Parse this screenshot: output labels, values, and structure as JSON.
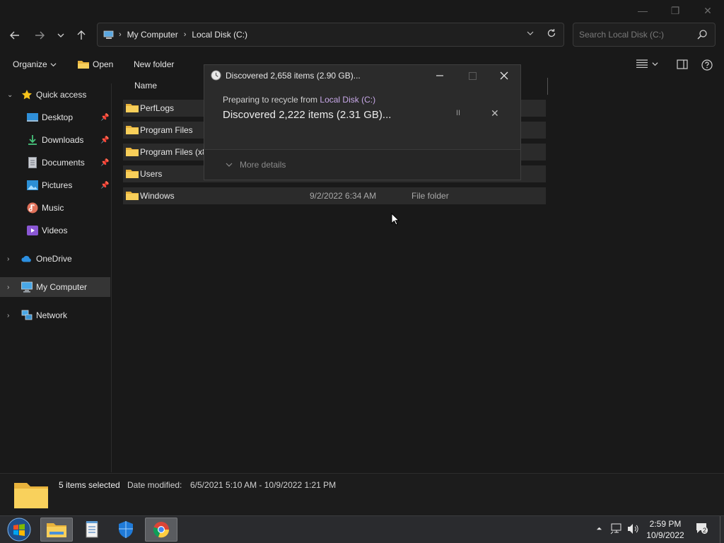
{
  "window": {
    "controls": {
      "minimize": "—",
      "restore": "❐",
      "close": "✕"
    }
  },
  "address": {
    "crumbs": [
      "My Computer",
      "Local Disk (C:)"
    ],
    "search_placeholder": "Search Local Disk (C:)"
  },
  "toolbar": {
    "organize": "Organize",
    "open": "Open",
    "new_folder": "New folder"
  },
  "sidebar": {
    "quick_access": "Quick access",
    "items": [
      {
        "label": "Desktop",
        "pinned": true
      },
      {
        "label": "Downloads",
        "pinned": true
      },
      {
        "label": "Documents",
        "pinned": true
      },
      {
        "label": "Pictures",
        "pinned": true
      },
      {
        "label": "Music",
        "pinned": false
      },
      {
        "label": "Videos",
        "pinned": false
      }
    ],
    "onedrive": "OneDrive",
    "my_computer": "My Computer",
    "network": "Network"
  },
  "file_list": {
    "column_name": "Name",
    "rows": [
      {
        "name": "PerfLogs",
        "date": "",
        "type": ""
      },
      {
        "name": "Program Files",
        "date": "",
        "type": ""
      },
      {
        "name": "Program Files (x8",
        "date": "",
        "type": ""
      },
      {
        "name": "Users",
        "date": "",
        "type": ""
      },
      {
        "name": "Windows",
        "date": "9/2/2022 6:34 AM",
        "type": "File folder"
      }
    ]
  },
  "dialog": {
    "title": "Discovered 2,658 items (2.90 GB)...",
    "subtitle_prefix": "Preparing to recycle from ",
    "subtitle_link": "Local Disk (C:)",
    "status": "Discovered 2,222 items (2.31 GB)...",
    "pause": "II",
    "cancel": "✕",
    "more_details": "More details"
  },
  "details": {
    "selected": "5 items selected",
    "date_label": "Date modified:",
    "date_value": "6/5/2021 5:10 AM - 10/9/2022 1:21 PM"
  },
  "taskbar": {
    "time": "2:59 PM",
    "date": "10/9/2022",
    "notifications": "2"
  }
}
